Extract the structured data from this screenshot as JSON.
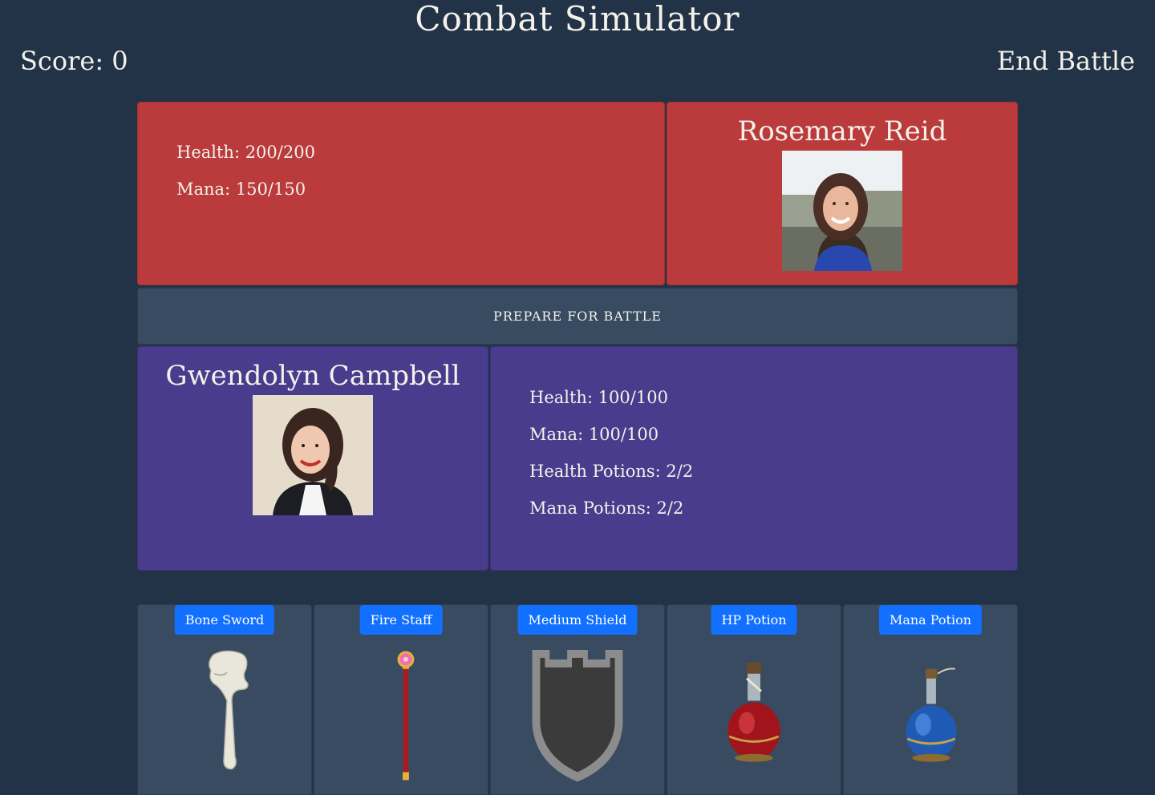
{
  "header": {
    "title": "Combat Simulator",
    "score": "Score: 0",
    "end_battle": "End Battle"
  },
  "enemy": {
    "name": "Rosemary Reid",
    "health": "Health: 200/200",
    "mana": "Mana: 150/150",
    "color": "#bb3b3c"
  },
  "message": "PREPARE FOR BATTLE",
  "player": {
    "name": "Gwendolyn Campbell",
    "health": "Health: 100/100",
    "mana": "Mana: 100/100",
    "health_potions": "Health Potions: 2/2",
    "mana_potions": "Mana Potions: 2/2",
    "color": "#4a3c8d"
  },
  "inventory": [
    {
      "label": "Bone Sword",
      "icon": "bone-sword-icon"
    },
    {
      "label": "Fire Staff",
      "icon": "fire-staff-icon"
    },
    {
      "label": "Medium Shield",
      "icon": "shield-icon"
    },
    {
      "label": "HP Potion",
      "icon": "red-potion-icon"
    },
    {
      "label": "Mana Potion",
      "icon": "blue-potion-icon"
    }
  ],
  "colors": {
    "background": "#233347",
    "button": "#1170ff",
    "slot": "#384b61"
  }
}
